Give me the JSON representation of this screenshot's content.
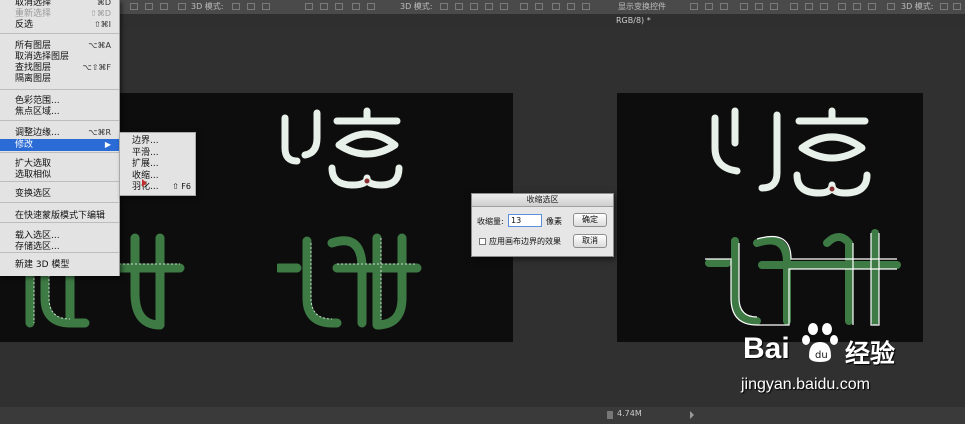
{
  "select_menu": {
    "items": [
      {
        "label": "取消选择",
        "shortcut": "⌘D",
        "disabled": false
      },
      {
        "label": "重新选择",
        "shortcut": "⇧⌘D",
        "disabled": true
      },
      {
        "label": "反选",
        "shortcut": "⇧⌘I",
        "disabled": false
      },
      {
        "label": "所有图层",
        "shortcut": "⌥⌘A",
        "disabled": false
      },
      {
        "label": "取消选择图层",
        "shortcut": "",
        "disabled": false
      },
      {
        "label": "查找图层",
        "shortcut": "⌥⇧⌘F",
        "disabled": false
      },
      {
        "label": "隔离图层",
        "shortcut": "",
        "disabled": false
      },
      {
        "label": "色彩范围...",
        "shortcut": "",
        "disabled": false
      },
      {
        "label": "焦点区域...",
        "shortcut": "",
        "disabled": false
      },
      {
        "label": "调整边缘...",
        "shortcut": "⌥⌘R",
        "disabled": false
      },
      {
        "label": "修改",
        "shortcut": "▶",
        "disabled": false
      },
      {
        "label": "扩大选取",
        "shortcut": "",
        "disabled": false
      },
      {
        "label": "选取相似",
        "shortcut": "",
        "disabled": false
      },
      {
        "label": "变换选区",
        "shortcut": "",
        "disabled": false
      },
      {
        "label": "在快速蒙版模式下编辑",
        "shortcut": "",
        "disabled": false
      },
      {
        "label": "载入选区...",
        "shortcut": "",
        "disabled": false
      },
      {
        "label": "存储选区...",
        "shortcut": "",
        "disabled": false
      },
      {
        "label": "新建 3D 模型",
        "shortcut": "",
        "disabled": false
      }
    ]
  },
  "modify_submenu": {
    "items": [
      {
        "label": "边界...",
        "shortcut": ""
      },
      {
        "label": "平滑...",
        "shortcut": ""
      },
      {
        "label": "扩展...",
        "shortcut": ""
      },
      {
        "label": "收缩...",
        "shortcut": ""
      },
      {
        "label": "羽化...",
        "shortcut": "⇧ F6"
      }
    ]
  },
  "contract_dialog": {
    "title": "收缩选区",
    "amount_label": "收缩量:",
    "amount_value": "13",
    "unit": "像素",
    "ok": "确定",
    "cancel": "取消",
    "checkbox_label": "应用画布边界的效果"
  },
  "toolbar": {
    "mode_3d_left": "3D 模式:",
    "mode_3d_mid": "3D 模式:",
    "show_transform": "显示变换控件",
    "mode_3d_right": "3D 模式:"
  },
  "document": {
    "tab_suffix": "RGB/8) *",
    "file_size": "4.74M"
  },
  "artwork": {
    "top_chars": "创意",
    "bottom_chars": "设计"
  },
  "watermark": {
    "brand_left": "Bai",
    "brand_right": "经验",
    "url": "jingyan.baidu.com"
  },
  "colors": {
    "white_stroke": "#e8f0ea",
    "green_stroke": "#3d7a44",
    "highlight": "#2a6bd6"
  }
}
